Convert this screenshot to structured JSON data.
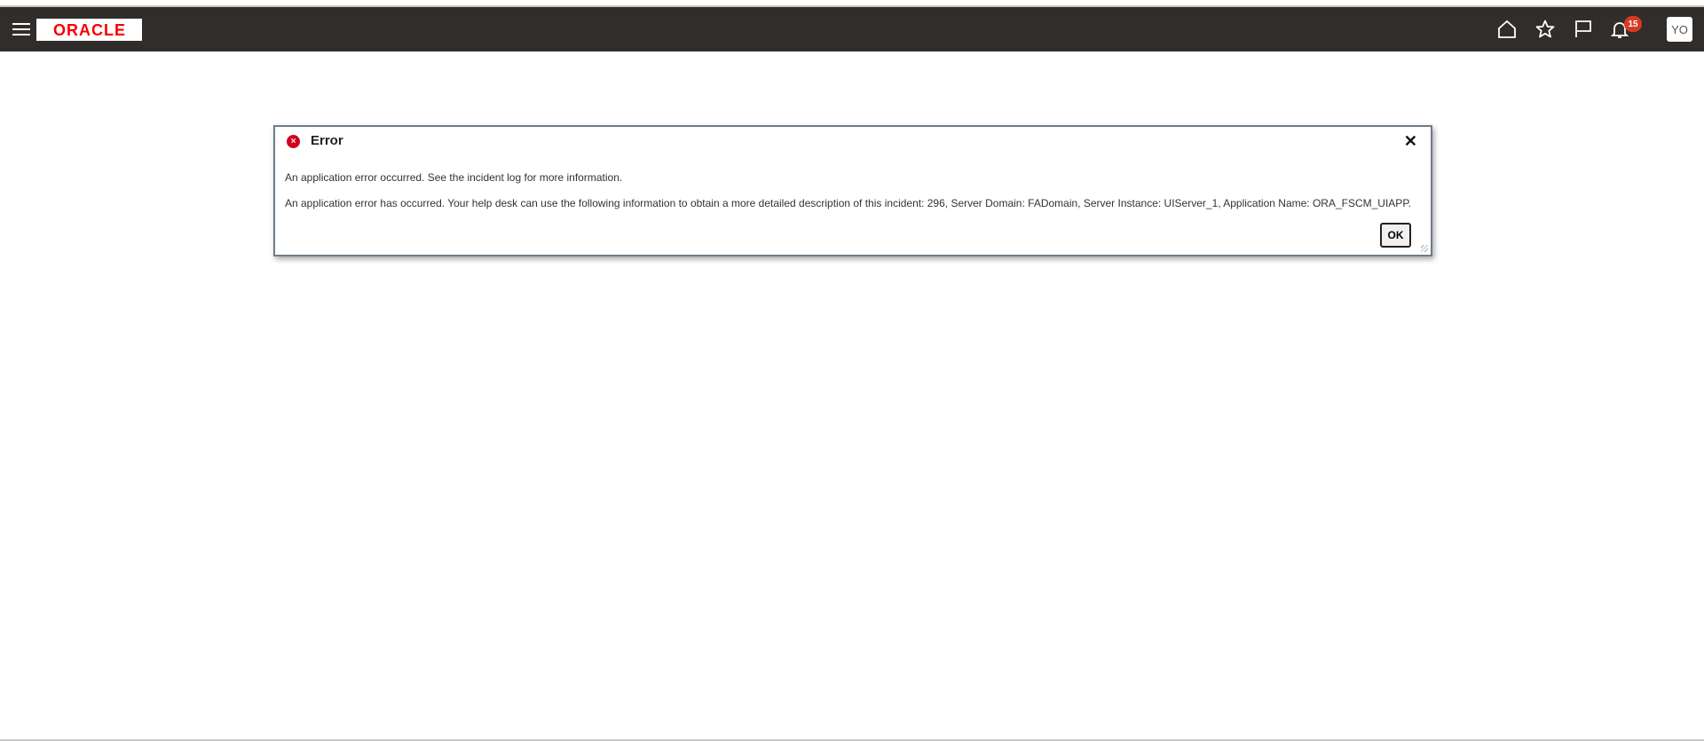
{
  "header": {
    "logo_text": "ORACLE",
    "notification_count": "15",
    "avatar_initials": "YO",
    "icons": [
      "menu-icon",
      "home-icon",
      "star-icon",
      "flag-icon",
      "bell-icon"
    ]
  },
  "dialog": {
    "title": "Error",
    "message_1": "An application error occurred. See the incident log for more information.",
    "message_2": "An application error has occurred. Your help desk can use the following information to obtain a more detailed description of this incident: 296, Server Domain: FADomain, Server Instance: UIServer_1, Application Name: ORA_FSCM_UIAPP.",
    "ok_label": "OK",
    "close_glyph": "✕",
    "error_glyph": "×"
  },
  "colors": {
    "header_bg": "#312d2a",
    "brand_red": "#f80000",
    "error_red": "#d3001b",
    "badge_red": "#d63b25"
  }
}
